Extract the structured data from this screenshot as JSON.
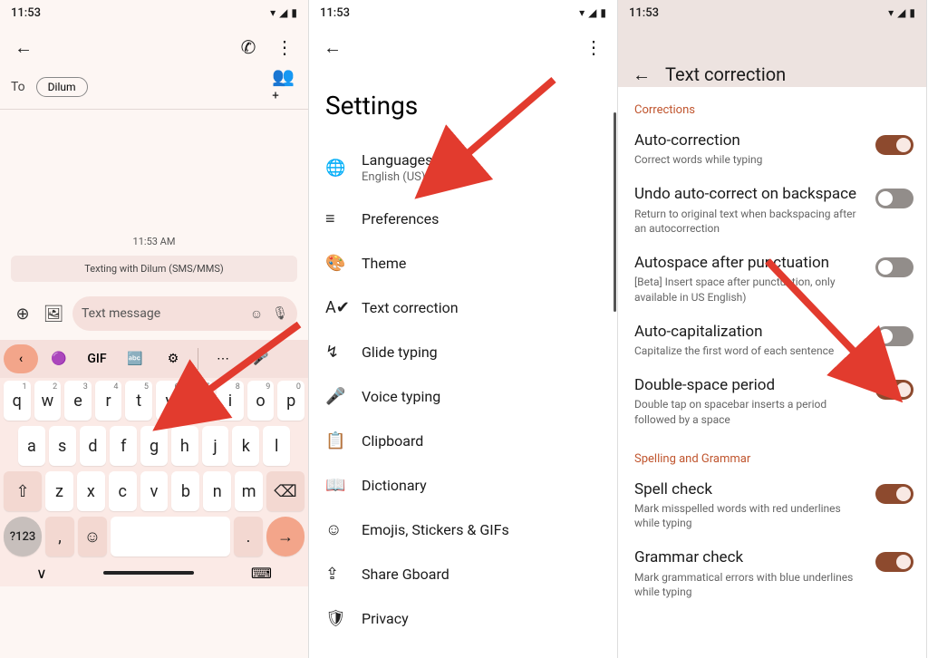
{
  "status": {
    "time": "11:53",
    "wifi": "▾",
    "signal": "▴",
    "battery": "▮"
  },
  "panel1": {
    "to_label": "To",
    "chip": "Dilum",
    "timestamp": "11:53 AM",
    "info": "Texting with Dilum (SMS/MMS)",
    "placeholder": "Text message",
    "gif": "GIF",
    "rows": {
      "r1": [
        "q",
        "w",
        "e",
        "r",
        "t",
        "y",
        "u",
        "i",
        "o",
        "p"
      ],
      "nums": [
        "1",
        "2",
        "3",
        "4",
        "5",
        "6",
        "7",
        "8",
        "9",
        "0"
      ],
      "r2": [
        "a",
        "s",
        "d",
        "f",
        "g",
        "h",
        "j",
        "k",
        "l"
      ],
      "r3": [
        "z",
        "x",
        "c",
        "v",
        "b",
        "n",
        "m"
      ]
    },
    "num123": "?123",
    "comma": ",",
    "period": "."
  },
  "panel2": {
    "title": "Settings",
    "items": [
      {
        "icon": "🌐",
        "label": "Languages",
        "sub": "English (US) (QWERTY)"
      },
      {
        "icon": "≡",
        "label": "Preferences"
      },
      {
        "icon": "🎨",
        "label": "Theme"
      },
      {
        "icon": "A✔",
        "label": "Text correction"
      },
      {
        "icon": "↯",
        "label": "Glide typing"
      },
      {
        "icon": "🎤",
        "label": "Voice typing"
      },
      {
        "icon": "📋",
        "label": "Clipboard"
      },
      {
        "icon": "📖",
        "label": "Dictionary"
      },
      {
        "icon": "☺",
        "label": "Emojis, Stickers & GIFs"
      },
      {
        "icon": "⇪",
        "label": "Share Gboard"
      },
      {
        "icon": "🛡",
        "label": "Privacy"
      }
    ]
  },
  "panel3": {
    "title": "Text correction",
    "section1": "Corrections",
    "section2": "Spelling and Grammar",
    "rows": [
      {
        "title": "Auto-correction",
        "desc": "Correct words while typing",
        "on": true
      },
      {
        "title": "Undo auto-correct on backspace",
        "desc": "Return to original text when backspacing after an autocorrection",
        "on": false
      },
      {
        "title": "Autospace after punctuation",
        "desc": "[Beta] Insert space after punctuation, only available in US English)",
        "on": false
      },
      {
        "title": "Auto-capitalization",
        "desc": "Capitalize the first word of each sentence",
        "on": false
      },
      {
        "title": "Double-space period",
        "desc": "Double tap on spacebar inserts a period followed by a space",
        "on": true
      },
      {
        "title": "Spell check",
        "desc": "Mark misspelled words with red underlines while typing",
        "on": true
      },
      {
        "title": "Grammar check",
        "desc": "Mark grammatical errors with blue underlines while typing",
        "on": true
      }
    ]
  }
}
